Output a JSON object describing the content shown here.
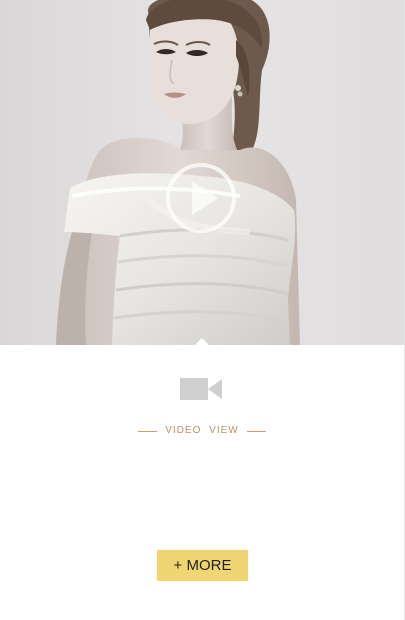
{
  "video_section": {
    "play_icon": "play-circle-icon",
    "camera_icon": "video-camera-icon",
    "label": "VIDEO  VIEW"
  },
  "more_button": {
    "label": "+ MORE"
  },
  "colors": {
    "label_accent": "#b8926a",
    "button_bg": "#f0d673",
    "camera_gray": "#cfcfcf"
  }
}
